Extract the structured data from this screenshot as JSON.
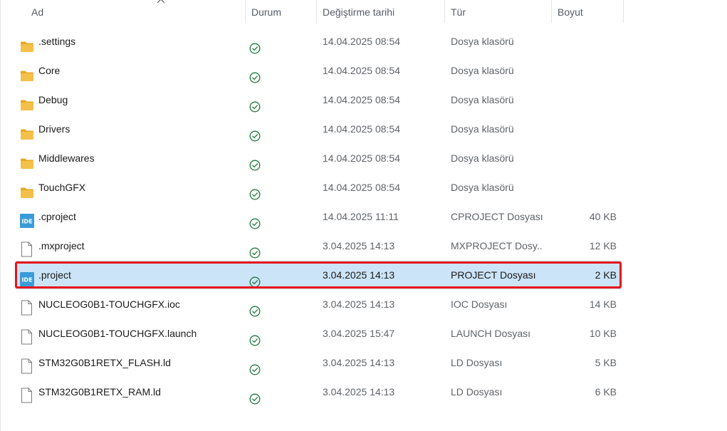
{
  "columns": {
    "name": "Ad",
    "status": "Durum",
    "modified": "Değiştirme tarihi",
    "type": "Tür",
    "size": "Boyut"
  },
  "colors": {
    "folder": "#f3c04a",
    "folder_dark": "#e6a823",
    "ide_badge": "#3a9bd9",
    "status_green": "#1e7a3e",
    "selected_row": "#cce4f7",
    "highlight_border": "#e8141b"
  },
  "files": [
    {
      "name": ".settings",
      "icon": "folder-icon",
      "status": "synced-check-icon",
      "modified": "14.04.2025 08:54",
      "type": "Dosya klasörü",
      "size": "",
      "selected": false
    },
    {
      "name": "Core",
      "icon": "folder-icon",
      "status": "synced-check-icon",
      "modified": "14.04.2025 08:54",
      "type": "Dosya klasörü",
      "size": "",
      "selected": false
    },
    {
      "name": "Debug",
      "icon": "folder-icon",
      "status": "synced-check-icon",
      "modified": "14.04.2025 08:54",
      "type": "Dosya klasörü",
      "size": "",
      "selected": false
    },
    {
      "name": "Drivers",
      "icon": "folder-icon",
      "status": "synced-check-icon",
      "modified": "14.04.2025 08:54",
      "type": "Dosya klasörü",
      "size": "",
      "selected": false
    },
    {
      "name": "Middlewares",
      "icon": "folder-icon",
      "status": "synced-check-icon",
      "modified": "14.04.2025 08:54",
      "type": "Dosya klasörü",
      "size": "",
      "selected": false
    },
    {
      "name": "TouchGFX",
      "icon": "folder-icon",
      "status": "synced-check-icon",
      "modified": "14.04.2025 08:54",
      "type": "Dosya klasörü",
      "size": "",
      "selected": false
    },
    {
      "name": ".cproject",
      "icon": "ide-file-icon",
      "status": "synced-check-icon",
      "modified": "14.04.2025 11:11",
      "type": "CPROJECT Dosyası",
      "size": "40 KB",
      "selected": false
    },
    {
      "name": ".mxproject",
      "icon": "blank-file-icon",
      "status": "synced-check-icon",
      "modified": "3.04.2025 14:13",
      "type": "MXPROJECT Dosy...",
      "size": "12 KB",
      "selected": false
    },
    {
      "name": ".project",
      "icon": "ide-file-icon",
      "status": "synced-check-icon",
      "modified": "3.04.2025 14:13",
      "type": "PROJECT Dosyası",
      "size": "2 KB",
      "selected": true
    },
    {
      "name": "NUCLEOG0B1-TOUCHGFX.ioc",
      "icon": "blank-file-icon",
      "status": "synced-check-icon",
      "modified": "3.04.2025 14:13",
      "type": "IOC Dosyası",
      "size": "14 KB",
      "selected": false
    },
    {
      "name": "NUCLEOG0B1-TOUCHGFX.launch",
      "icon": "blank-file-icon",
      "status": "synced-check-icon",
      "modified": "3.04.2025 15:47",
      "type": "LAUNCH Dosyası",
      "size": "10 KB",
      "selected": false
    },
    {
      "name": "STM32G0B1RETX_FLASH.ld",
      "icon": "blank-file-icon",
      "status": "synced-check-icon",
      "modified": "3.04.2025 14:13",
      "type": "LD Dosyası",
      "size": "5 KB",
      "selected": false
    },
    {
      "name": "STM32G0B1RETX_RAM.ld",
      "icon": "blank-file-icon",
      "status": "synced-check-icon",
      "modified": "3.04.2025 14:13",
      "type": "LD Dosyası",
      "size": "6 KB",
      "selected": false
    }
  ],
  "ide_badge_text": "IDE"
}
